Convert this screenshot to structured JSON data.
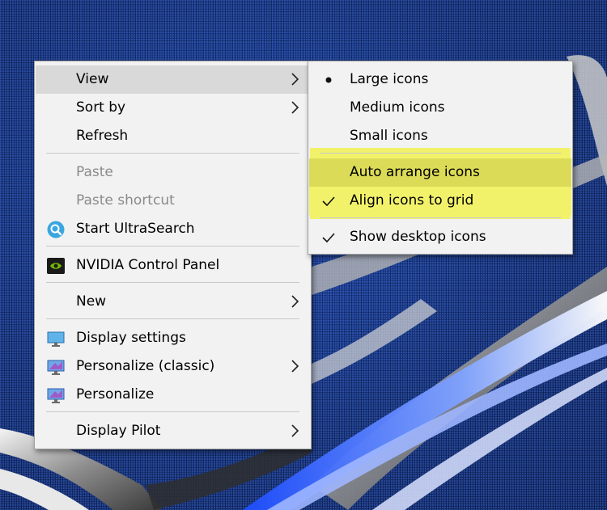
{
  "context_menu": {
    "items": [
      {
        "label": "View"
      },
      {
        "label": "Sort by"
      },
      {
        "label": "Refresh"
      },
      {
        "label": "Paste"
      },
      {
        "label": "Paste shortcut"
      },
      {
        "label": "Start UltraSearch"
      },
      {
        "label": "NVIDIA Control Panel"
      },
      {
        "label": "New"
      },
      {
        "label": "Display settings"
      },
      {
        "label": "Personalize (classic)"
      },
      {
        "label": "Personalize"
      },
      {
        "label": "Display Pilot"
      }
    ]
  },
  "view_submenu": {
    "items": [
      {
        "label": "Large icons",
        "selected": true
      },
      {
        "label": "Medium icons",
        "selected": false
      },
      {
        "label": "Small icons",
        "selected": false
      },
      {
        "label": "Auto arrange icons",
        "checked": false
      },
      {
        "label": "Align icons to grid",
        "checked": true
      },
      {
        "label": "Show desktop icons",
        "checked": true
      }
    ]
  },
  "colors": {
    "highlight": "#f1f26a",
    "menu_background": "#f2f2f2",
    "hover": "#d9d9d9",
    "disabled_text": "#8a8a8a"
  }
}
